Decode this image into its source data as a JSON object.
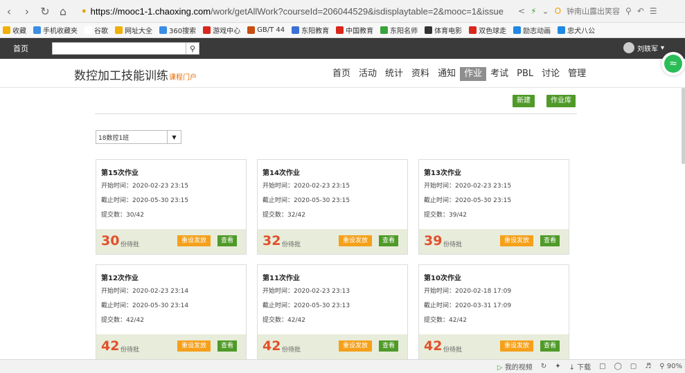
{
  "browser": {
    "url_host": "https://mooc1-1.chaoxing.com",
    "url_path": "/work/getAllWork?courseId=206044529&isdisplaytable=2&mooc=1&issue",
    "search_suggestion": "钟南山露出笑容"
  },
  "bookmarks": [
    {
      "label": "收藏",
      "color": "#f0b000"
    },
    {
      "label": "手机收藏夹",
      "color": "#3a8ee6"
    },
    {
      "label": "谷歌",
      "color": "#ffffff"
    },
    {
      "label": "网址大全",
      "color": "#f0b000"
    },
    {
      "label": "360搜索",
      "color": "#3a8ee6"
    },
    {
      "label": "游戏中心",
      "color": "#d9261c"
    },
    {
      "label": "GB/T 44",
      "color": "#c84d10"
    },
    {
      "label": "东阳教育",
      "color": "#3b70d6"
    },
    {
      "label": "中国教育",
      "color": "#d9261c"
    },
    {
      "label": "东阳名师",
      "color": "#3aa33a"
    },
    {
      "label": "体育电影",
      "color": "#333333"
    },
    {
      "label": "双色球走",
      "color": "#d9261c"
    },
    {
      "label": "励志动画",
      "color": "#1e88e5"
    },
    {
      "label": "忠犬八公",
      "color": "#1e88e5"
    }
  ],
  "site": {
    "home": "首页",
    "user": "刘轶军"
  },
  "course": {
    "title": "数控加工技能训练",
    "portal": "课程门户",
    "nav": [
      "首页",
      "活动",
      "统计",
      "资料",
      "通知",
      "作业",
      "考试",
      "PBL",
      "讨论",
      "管理"
    ],
    "active_nav": "作业"
  },
  "actions": {
    "new": "新建",
    "library": "作业库"
  },
  "class_select": {
    "selected": "18数控1班"
  },
  "labels": {
    "start": "开始时间：",
    "end": "截止时间：",
    "submitted": "提交数：",
    "pending": "份待批",
    "reset": "重设发放",
    "view": "查看"
  },
  "assignments": [
    {
      "title": "第15次作业",
      "start": "2020-02-23 23:15",
      "end": "2020-05-30 23:15",
      "submitted": "30/42",
      "pending": "30"
    },
    {
      "title": "第14次作业",
      "start": "2020-02-23 23:15",
      "end": "2020-05-30 23:15",
      "submitted": "32/42",
      "pending": "32"
    },
    {
      "title": "第13次作业",
      "start": "2020-02-23 23:15",
      "end": "2020-05-30 23:15",
      "submitted": "39/42",
      "pending": "39"
    },
    {
      "title": "第12次作业",
      "start": "2020-02-23 23:14",
      "end": "2020-05-30 23:14",
      "submitted": "42/42",
      "pending": "42"
    },
    {
      "title": "第11次作业",
      "start": "2020-02-23 23:13",
      "end": "2020-05-30 23:13",
      "submitted": "42/42",
      "pending": "42"
    },
    {
      "title": "第10次作业",
      "start": "2020-02-18 17:09",
      "end": "2020-03-31 17:09",
      "submitted": "42/42",
      "pending": "42"
    }
  ],
  "statusbar": {
    "video": "我的视频",
    "download": "下载",
    "zoom": "90%"
  },
  "colors": {
    "green": "#4f9a29",
    "orange": "#f5a01a",
    "pending_red": "#e0502a",
    "card_footer": "#e8ecda"
  }
}
